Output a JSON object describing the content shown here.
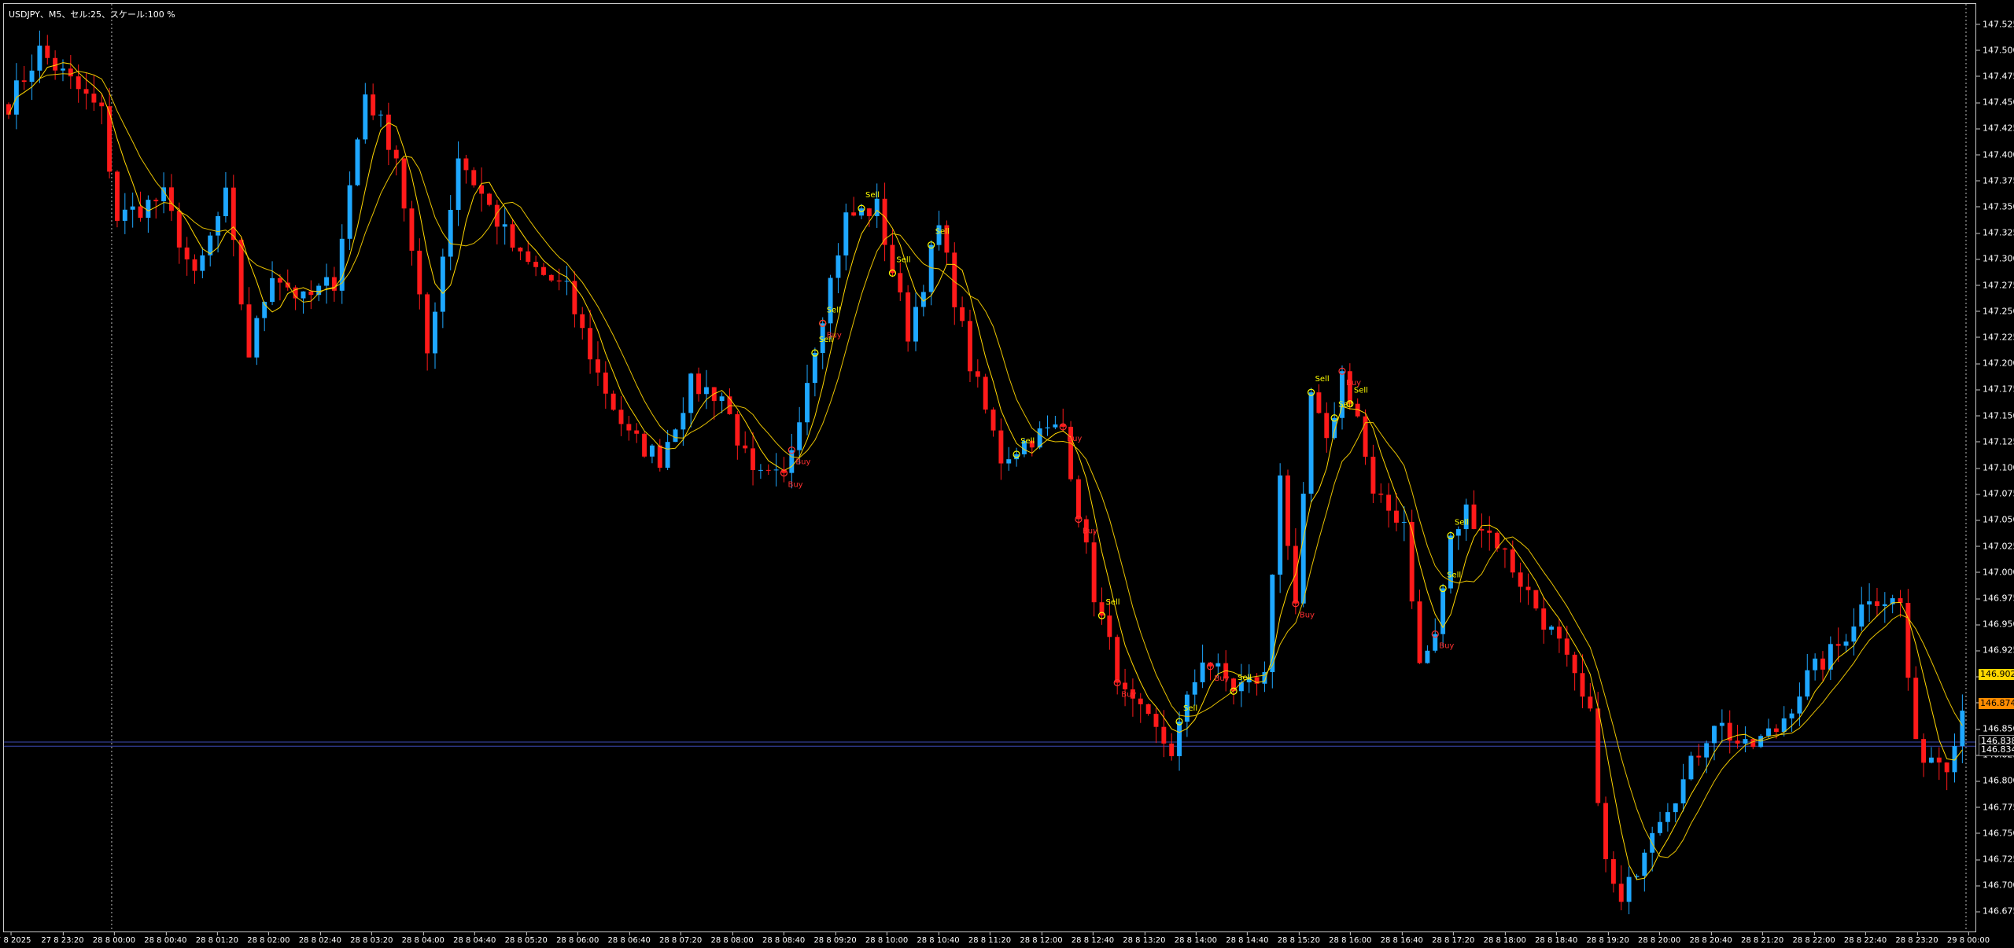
{
  "window": {
    "title": "USDJPY、M5、セル:25、スケール:100 %"
  },
  "colors": {
    "background": "#000000",
    "bull_candle": "#1ea7ff",
    "bear_candle": "#ff1a1a",
    "ma": "#ffd700",
    "grid_frame": "#c8c8c8",
    "hline": "#3e4bb5",
    "sell_label": "#ffff00",
    "buy_label": "#ff3030",
    "badge_yellow": "#ffd700",
    "badge_orange": "#ff8c00"
  },
  "price_axis": {
    "min": 146.655,
    "max": 147.545,
    "ticks": [
      "147.525",
      "147.500",
      "147.475",
      "147.450",
      "147.425",
      "147.400",
      "147.375",
      "147.350",
      "147.325",
      "147.300",
      "147.275",
      "147.250",
      "147.225",
      "147.200",
      "147.175",
      "147.150",
      "147.125",
      "147.100",
      "147.075",
      "147.050",
      "147.025",
      "147.000",
      "146.975",
      "146.950",
      "146.925",
      "146.900",
      "146.875",
      "146.850",
      "146.825",
      "146.800",
      "146.775",
      "146.750",
      "146.725",
      "146.700",
      "146.675"
    ],
    "badges": [
      {
        "label": "146.902",
        "value": 146.902,
        "bg": "#ffd700",
        "fg": "#000000"
      },
      {
        "label": "146.874",
        "value": 146.874,
        "bg": "#ff8c00",
        "fg": "#000000"
      },
      {
        "label": "146.838",
        "value": 146.838,
        "bg": "#000000",
        "fg": "#ffffff"
      },
      {
        "label": "146.834",
        "value": 146.834,
        "bg": "#000000",
        "fg": "#ffffff"
      }
    ],
    "hlines": [
      146.838,
      146.834
    ]
  },
  "time_axis": {
    "ticks": [
      "27 8 2025",
      "27 8 23:20",
      "28 8 00:00",
      "28 8 00:40",
      "28 8 01:20",
      "28 8 02:00",
      "28 8 02:40",
      "28 8 03:20",
      "28 8 04:00",
      "28 8 04:40",
      "28 8 05:20",
      "28 8 06:00",
      "28 8 06:40",
      "28 8 07:20",
      "28 8 08:00",
      "28 8 08:40",
      "28 8 09:20",
      "28 8 10:00",
      "28 8 10:40",
      "28 8 11:20",
      "28 8 12:00",
      "28 8 12:40",
      "28 8 13:20",
      "28 8 14:00",
      "28 8 14:40",
      "28 8 15:20",
      "28 8 16:00",
      "28 8 16:40",
      "28 8 17:20",
      "28 8 18:00",
      "28 8 18:40",
      "28 8 19:20",
      "28 8 20:00",
      "28 8 20:40",
      "28 8 21:20",
      "28 8 22:00",
      "28 8 22:40",
      "28 8 23:20",
      "29 8 00:00"
    ],
    "day_separators": [
      "28 8 00:00",
      "29 8 00:00"
    ]
  },
  "chart_data": {
    "type": "candlestick",
    "symbol": "USDJPY",
    "timeframe": "M5",
    "ylim": [
      146.655,
      147.545
    ],
    "waypoints": [
      [
        0,
        147.45
      ],
      [
        4,
        147.5
      ],
      [
        8,
        147.47
      ],
      [
        12,
        147.44
      ],
      [
        14,
        147.34
      ],
      [
        20,
        147.36
      ],
      [
        24,
        147.28
      ],
      [
        28,
        147.36
      ],
      [
        31,
        147.21
      ],
      [
        34,
        147.29
      ],
      [
        38,
        147.26
      ],
      [
        42,
        147.28
      ],
      [
        46,
        147.46
      ],
      [
        50,
        147.4
      ],
      [
        54,
        147.21
      ],
      [
        58,
        147.4
      ],
      [
        62,
        147.35
      ],
      [
        66,
        147.3
      ],
      [
        72,
        147.27
      ],
      [
        76,
        147.19
      ],
      [
        80,
        147.13
      ],
      [
        84,
        147.11
      ],
      [
        88,
        147.18
      ],
      [
        92,
        147.17
      ],
      [
        96,
        147.09
      ],
      [
        100,
        147.09
      ],
      [
        104,
        147.22
      ],
      [
        108,
        147.34
      ],
      [
        112,
        147.35
      ],
      [
        116,
        147.23
      ],
      [
        120,
        147.33
      ],
      [
        124,
        147.2
      ],
      [
        128,
        147.11
      ],
      [
        132,
        147.13
      ],
      [
        136,
        147.14
      ],
      [
        140,
        146.98
      ],
      [
        144,
        146.88
      ],
      [
        150,
        146.83
      ],
      [
        154,
        146.92
      ],
      [
        158,
        146.89
      ],
      [
        162,
        146.9
      ],
      [
        164,
        147.1
      ],
      [
        166,
        146.96
      ],
      [
        168,
        147.17
      ],
      [
        170,
        147.12
      ],
      [
        172,
        147.19
      ],
      [
        174,
        147.15
      ],
      [
        176,
        147.07
      ],
      [
        180,
        147.05
      ],
      [
        182,
        146.91
      ],
      [
        184,
        146.94
      ],
      [
        186,
        147.03
      ],
      [
        188,
        147.06
      ],
      [
        192,
        147.03
      ],
      [
        196,
        146.98
      ],
      [
        200,
        146.93
      ],
      [
        204,
        146.86
      ],
      [
        206,
        146.72
      ],
      [
        208,
        146.68
      ],
      [
        212,
        146.76
      ],
      [
        216,
        146.8
      ],
      [
        220,
        146.86
      ],
      [
        224,
        146.83
      ],
      [
        228,
        146.85
      ],
      [
        232,
        146.9
      ],
      [
        236,
        146.93
      ],
      [
        240,
        146.98
      ],
      [
        244,
        146.97
      ],
      [
        246,
        146.83
      ],
      [
        250,
        146.82
      ],
      [
        252,
        146.87
      ]
    ],
    "signals": [
      {
        "type": "Sell",
        "i": 104
      },
      {
        "type": "Sell",
        "i": 105
      },
      {
        "type": "Sell",
        "i": 110
      },
      {
        "type": "Sell",
        "i": 114
      },
      {
        "type": "Sell",
        "i": 119
      },
      {
        "type": "Buy",
        "i": 101
      },
      {
        "type": "Buy",
        "i": 100
      },
      {
        "type": "Buy",
        "i": 105
      },
      {
        "type": "Sell",
        "i": 130
      },
      {
        "type": "Buy",
        "i": 136
      },
      {
        "type": "Buy",
        "i": 138
      },
      {
        "type": "Sell",
        "i": 141
      },
      {
        "type": "Buy",
        "i": 143
      },
      {
        "type": "Sell",
        "i": 151
      },
      {
        "type": "Buy",
        "i": 155
      },
      {
        "type": "Sell",
        "i": 158
      },
      {
        "type": "Sell",
        "i": 168
      },
      {
        "type": "Sell",
        "i": 171
      },
      {
        "type": "Sell",
        "i": 173
      },
      {
        "type": "Buy",
        "i": 172
      },
      {
        "type": "Buy",
        "i": 166
      },
      {
        "type": "Sell",
        "i": 185
      },
      {
        "type": "Sell",
        "i": 186
      },
      {
        "type": "Buy",
        "i": 184
      }
    ],
    "signal_labels": {
      "sell": "Sell",
      "buy": "Buy"
    }
  }
}
